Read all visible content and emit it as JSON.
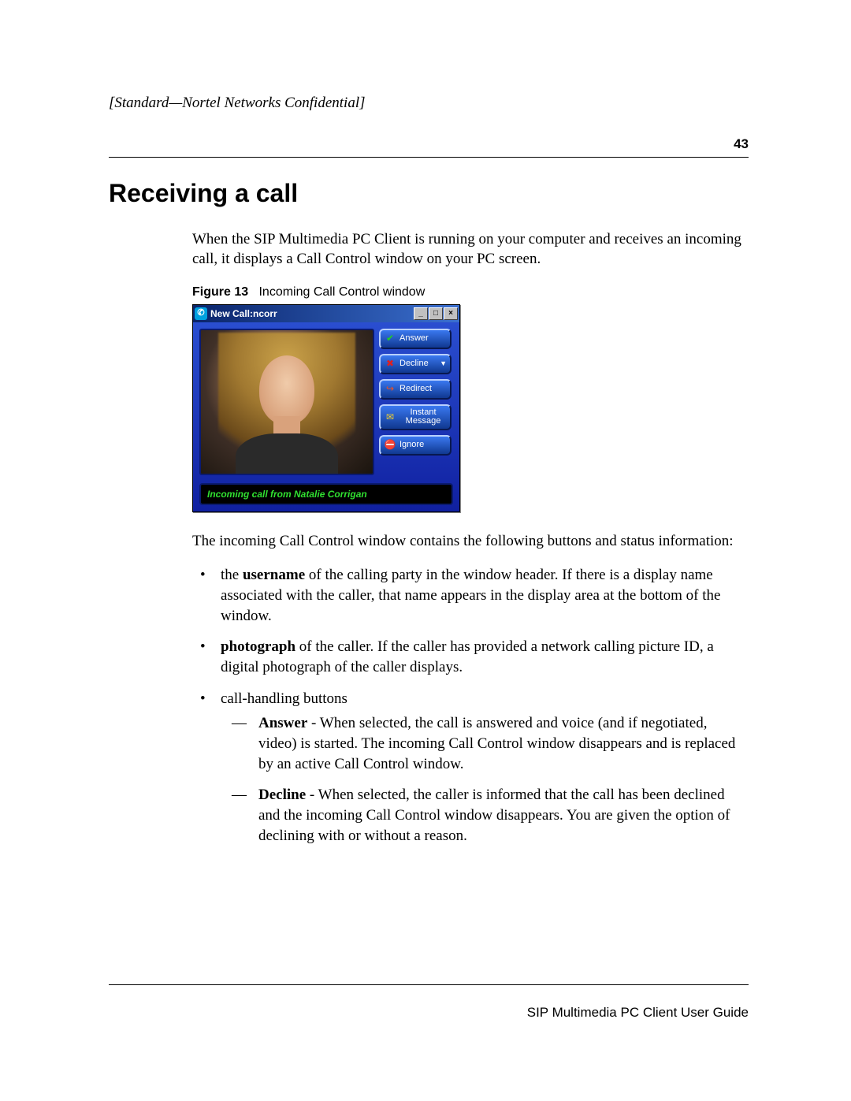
{
  "header": {
    "confidential": "[Standard—Nortel Networks Confidential]",
    "page_number": "43"
  },
  "section": {
    "title": "Receiving a call",
    "intro": "When the SIP Multimedia PC Client is running on your computer and receives an incoming call, it displays a Call Control window on your PC screen."
  },
  "figure": {
    "label": "Figure 13",
    "caption": "Incoming Call Control window",
    "window": {
      "title": "New Call:ncorr",
      "buttons": {
        "answer": "Answer",
        "decline": "Decline",
        "redirect": "Redirect",
        "instant_message": "Instant Message",
        "ignore": "Ignore"
      },
      "status": "Incoming call from Natalie Corrigan"
    },
    "win_controls": {
      "minimize": "_",
      "maximize": "□",
      "close": "×"
    }
  },
  "after_figure": "The incoming Call Control window contains the following buttons and status information:",
  "bullets": {
    "b1": {
      "pre": "the ",
      "bold": "username",
      "post": " of the calling party in the window header. If there is a display name associated with the caller, that name appears in the display area at the bottom of the window."
    },
    "b2": {
      "bold": "photograph",
      "post": " of the caller. If the caller has provided a network calling picture ID, a digital photograph of the caller displays."
    },
    "b3": {
      "text": "call-handling buttons"
    }
  },
  "dashes": {
    "d1": {
      "bold": "Answer",
      "post": " - When selected, the call is answered and voice (and if negotiated, video) is started. The incoming Call Control window disappears and is replaced by an active Call Control window."
    },
    "d2": {
      "bold": "Decline",
      "post": " - When selected, the caller is informed that the call has been declined and the incoming Call Control window disappears. You are given the option of declining with or without a reason."
    }
  },
  "footer": {
    "guide": "SIP Multimedia PC Client User Guide"
  }
}
